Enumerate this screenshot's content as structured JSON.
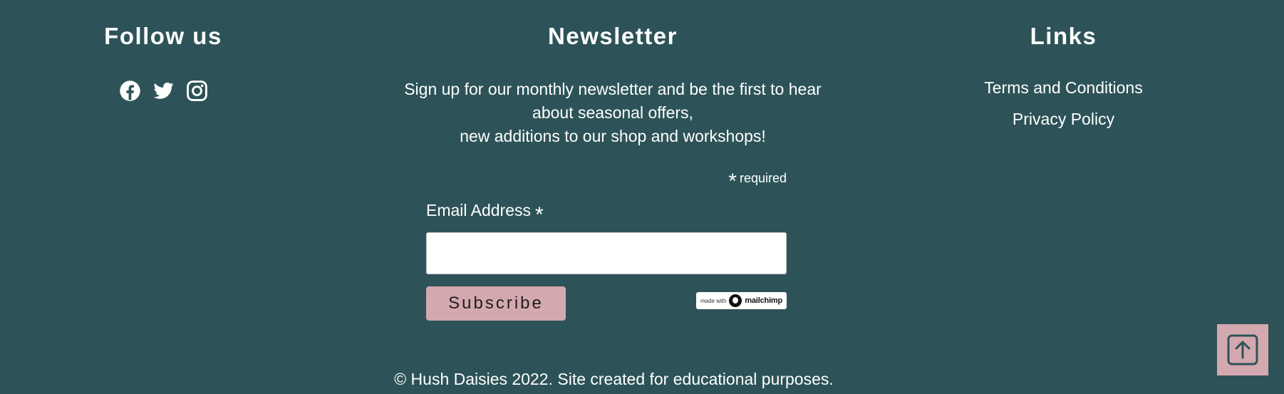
{
  "follow": {
    "title": "Follow us",
    "icons": [
      "facebook-icon",
      "twitter-icon",
      "instagram-icon"
    ]
  },
  "newsletter": {
    "title": "Newsletter",
    "description_line1": "Sign up for our monthly newsletter and be the first to hear about seasonal offers,",
    "description_line2": "new additions to our shop and workshops!",
    "required_marker": "*",
    "required_text": "required",
    "email_label": "Email Address",
    "email_value": "",
    "email_placeholder": "",
    "subscribe_label": "Subscribe",
    "badge_small": "made with",
    "badge_brand": "mailchimp"
  },
  "links": {
    "title": "Links",
    "items": [
      {
        "label": "Terms and Conditions"
      },
      {
        "label": "Privacy Policy"
      }
    ]
  },
  "footer": {
    "copyright": "© Hush Daisies 2022. Site created for educational purposes."
  },
  "back_to_top": {
    "icon": "arrow-up-square-icon"
  },
  "colors": {
    "background": "#2d5358",
    "accent": "#d4a8af",
    "text": "#ffffff"
  }
}
